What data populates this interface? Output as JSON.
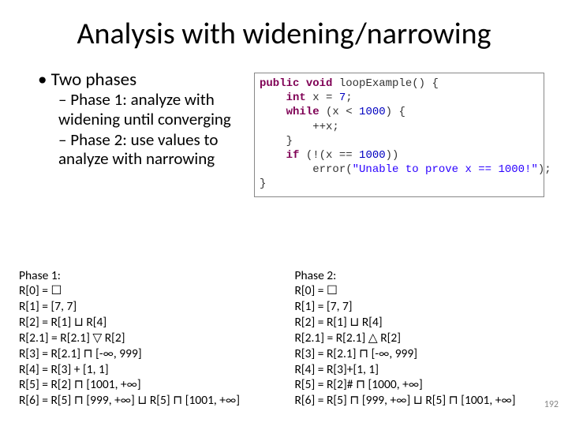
{
  "title": "Analysis with widening/narrowing",
  "bullets": {
    "lvl1": "Two phases",
    "lvl2": [
      "Phase 1: analyze with widening until converging",
      "Phase 2: use values to analyze with narrowing"
    ]
  },
  "code": {
    "l1a": "public",
    "l1b": " void",
    "l1c": " loopExample() {",
    "l2a": "    int",
    "l2b": " x = ",
    "l2n": "7",
    "l2c": ";",
    "l3a": "    while",
    "l3b": " (x < ",
    "l3n": "1000",
    "l3c": ") {",
    "l4": "        ++x;",
    "l5": "    }",
    "l6a": "    if",
    "l6b": " (!(x == ",
    "l6n": "1000",
    "l6c": "))",
    "l7a": "        error(",
    "l7s": "\"Unable to prove x == 1000!\"",
    "l7b": ");",
    "l8": "}"
  },
  "phase1": {
    "title": "Phase 1:",
    "r0": "R[0] = ☐",
    "r1": "R[1] = [7, 7]",
    "r2": "R[2] = R[1] ⊔ R[4]",
    "r21": "R[2.1] = R[2.1] ▽ R[2]",
    "r3": "R[3] = R[2.1] ⊓ [-∞, 999]",
    "r4": "R[4] = R[3] + [1, 1]",
    "r5": "R[5] = R[2] ⊓ [1001, +∞]",
    "r6": "R[6] = R[5] ⊓ [999, +∞] ⊔ R[5] ⊓ [1001, +∞]"
  },
  "phase2": {
    "title": "Phase 2:",
    "r0": "R[0] = ☐",
    "r1": "R[1] = [7, 7]",
    "r2": "R[2] = R[1] ⊔ R[4]",
    "r21": "R[2.1] = R[2.1] △ R[2]",
    "r3": "R[3] = R[2.1] ⊓ [-∞, 999]",
    "r4": "R[4] = R[3]+[1, 1]",
    "r5": "R[5] = R[2]# ⊓ [1000, +∞]",
    "r6": "R[6] = R[5] ⊓ [999, +∞] ⊔ R[5] ⊓ [1001, +∞]"
  },
  "pagenum": "192"
}
